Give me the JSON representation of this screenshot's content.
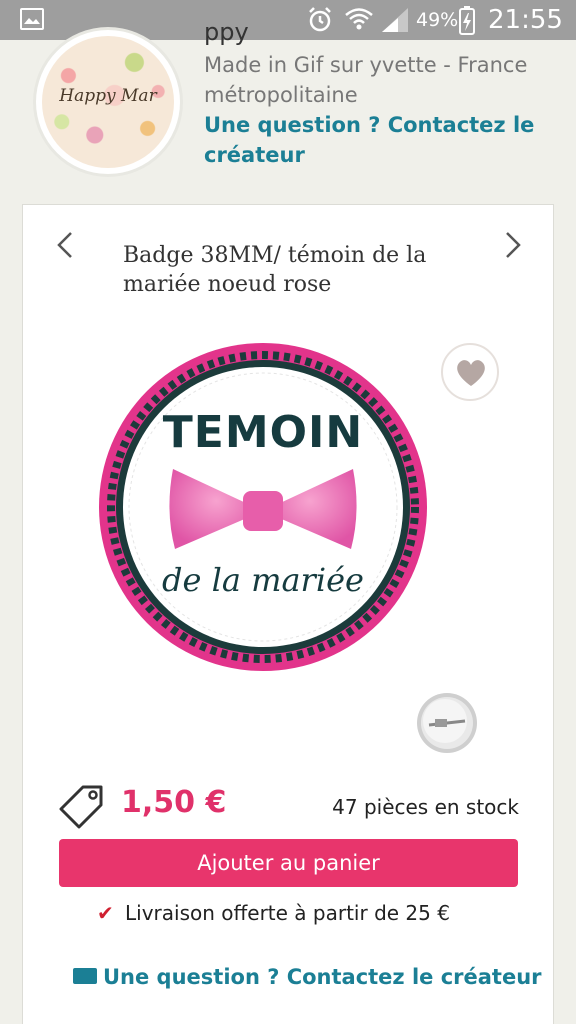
{
  "status_bar": {
    "battery_percent": "49%",
    "time": "21:55",
    "icons": [
      "gallery-icon",
      "alarm-icon",
      "wifi-icon",
      "signal-icon",
      "battery-charging-icon"
    ]
  },
  "shop": {
    "logo_text": "Happy Mar",
    "title_partial": "ppy",
    "location": "Made in Gif sur yvette - France métropolitaine",
    "contact_link": "Une question ? Contactez le créateur"
  },
  "product": {
    "title": "Badge 38MM/ témoin de la mariée noeud rose",
    "badge_text_top": "TEMOIN",
    "badge_text_bottom": "de la mariée",
    "price": "1,50 €",
    "stock": "47 pièces en stock",
    "add_to_cart_label": "Ajouter au panier",
    "delivery_text": "Livraison offerte à partir de 25 €",
    "contact_link": "Une question ? Contactez le créateur"
  },
  "colors": {
    "status_bar": "#9e9e9e",
    "accent_pink": "#e8356c",
    "price_pink": "#e0316a",
    "link_teal": "#1b7f95",
    "background": "#f0f0ea"
  }
}
